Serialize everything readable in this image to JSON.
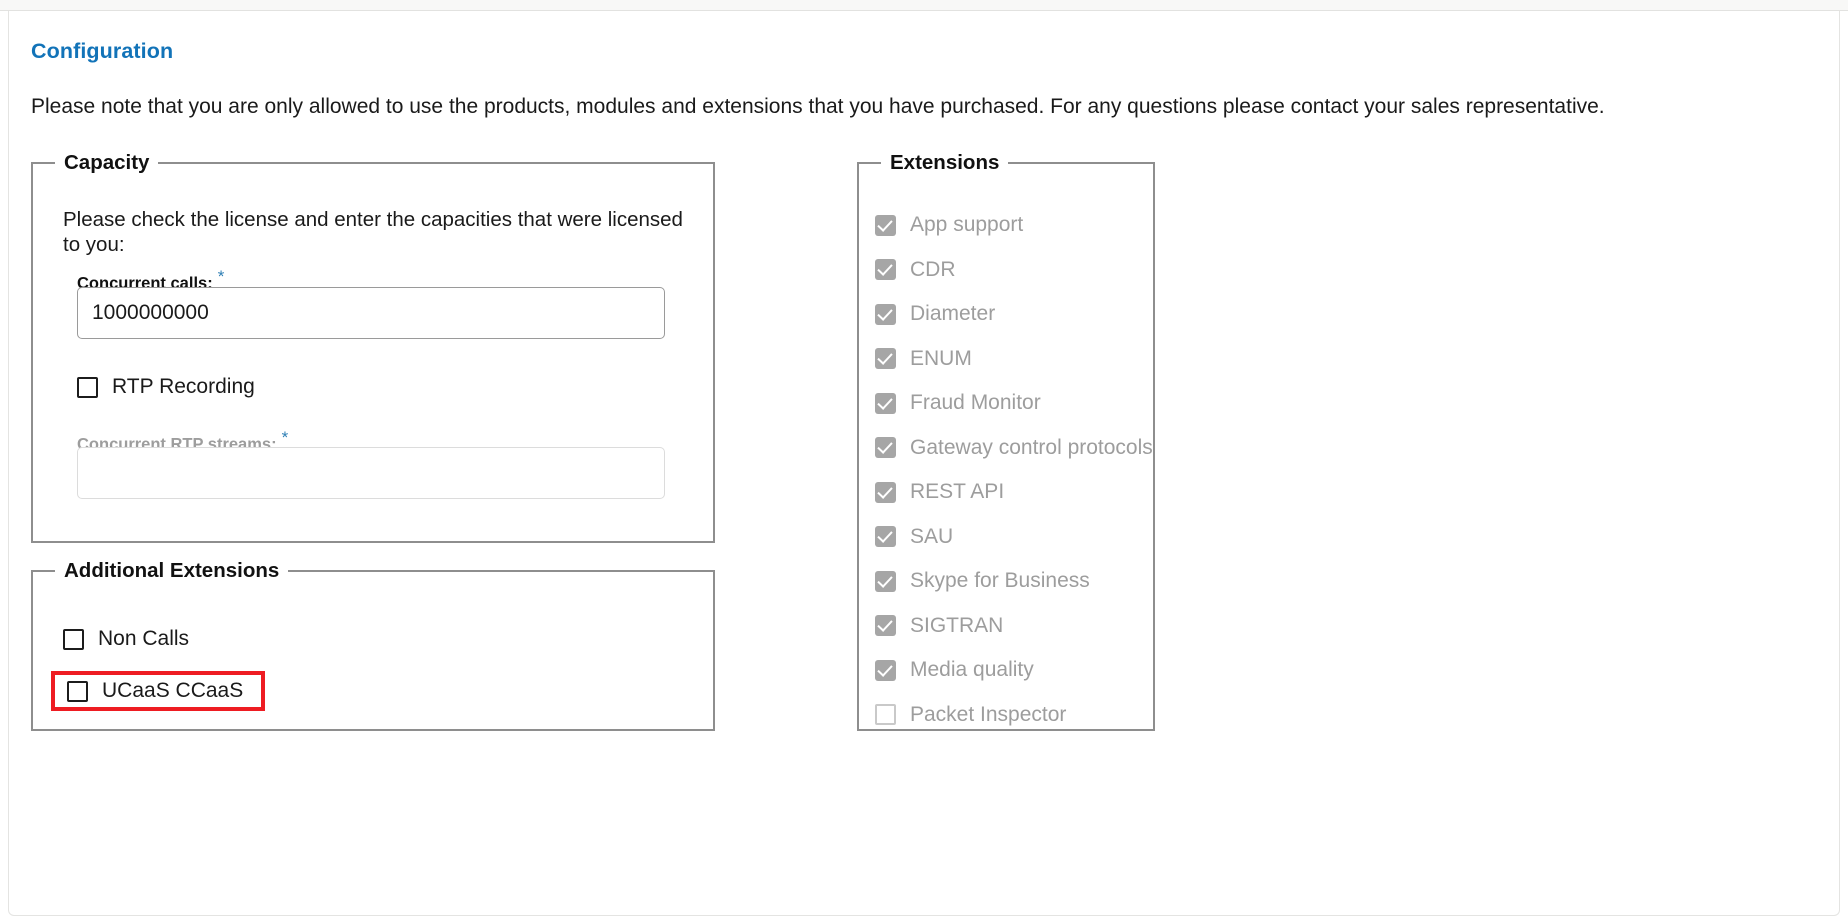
{
  "page": {
    "title": "Configuration",
    "note": "Please note that you are only allowed to use the products, modules and extensions that you have purchased. For any questions please contact your sales representative."
  },
  "capacity": {
    "legend": "Capacity",
    "note": "Please check the license and enter the capacities that were licensed to you:",
    "concurrent_calls": {
      "label": "Concurrent calls:",
      "required_marker": "*",
      "value": "1000000000",
      "placeholder": ""
    },
    "rtp_recording": {
      "label": "RTP Recording",
      "checked": false
    },
    "rtp_streams": {
      "label": "Concurrent RTP streams:",
      "required_marker": "*",
      "value": "",
      "placeholder": "",
      "disabled": true
    }
  },
  "additional_extensions": {
    "legend": "Additional Extensions",
    "items": [
      {
        "label": "Non Calls",
        "checked": false,
        "highlighted": false
      },
      {
        "label": "UCaaS CCaaS",
        "checked": false,
        "highlighted": true
      }
    ]
  },
  "extensions": {
    "legend": "Extensions",
    "items": [
      {
        "label": "App support",
        "checked": true
      },
      {
        "label": "CDR",
        "checked": true
      },
      {
        "label": "Diameter",
        "checked": true
      },
      {
        "label": "ENUM",
        "checked": true
      },
      {
        "label": "Fraud Monitor",
        "checked": true
      },
      {
        "label": "Gateway control protocols",
        "checked": true
      },
      {
        "label": "REST API",
        "checked": true
      },
      {
        "label": "SAU",
        "checked": true
      },
      {
        "label": "Skype for Business",
        "checked": true
      },
      {
        "label": "SIGTRAN",
        "checked": true
      },
      {
        "label": "Media quality",
        "checked": true
      },
      {
        "label": "Packet Inspector",
        "checked": false
      }
    ]
  },
  "colors": {
    "title_blue": "#1273b8",
    "required_asterisk": "#2f7fb5",
    "highlight_red": "#ee1c22",
    "disabled_grey": "#9d9d9d",
    "checkbox_checked_grey": "#a6a6a6"
  }
}
